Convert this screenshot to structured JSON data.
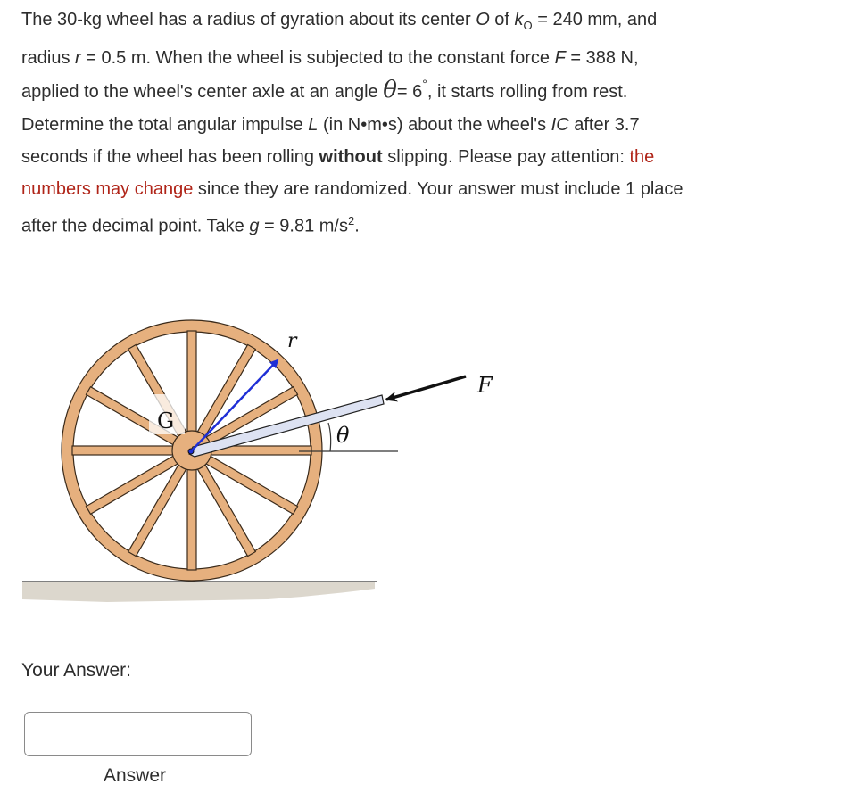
{
  "question": {
    "line1": {
      "a": "The 30-kg wheel has a radius of gyration about its center ",
      "O": "O",
      "b": " of ",
      "k": "k",
      "k_sub": "O",
      "c": " = 240 mm, and"
    },
    "line2": {
      "a": "radius ",
      "r": "r",
      "b": " = 0.5 m. When the wheel is subjected to the constant force ",
      "F": "F",
      "c": " = 388 N,"
    },
    "line3": {
      "a": "applied to the wheel's center axle at an angle ",
      "theta": "θ",
      "b": "= 6",
      "deg": "°",
      "c": ", it starts rolling from rest."
    },
    "line4": {
      "a": "Determine the total angular impulse ",
      "L": "L",
      "b": " (in N•m•s) about the wheel's ",
      "IC": "IC",
      "c": " after 3.7"
    },
    "line5": {
      "a": "seconds if the wheel has been rolling ",
      "bold": "without",
      "b": " slipping. Please pay attention: ",
      "red": "the"
    },
    "line6": {
      "red": "numbers may change",
      "a": " since they are randomized. Your answer must include 1 place"
    },
    "line7": {
      "a": "after the decimal point. Take ",
      "g": "g",
      "b": " = 9.81 m/s",
      "sup": "2",
      "c": "."
    }
  },
  "figure": {
    "label_G": "G",
    "label_r": "r",
    "label_F": "F",
    "label_theta": "θ",
    "colors": {
      "wheel_fill": "#e6b07e",
      "outline": "#3a2a1a",
      "radius_arrow": "#1f2fd6",
      "rotation_arrow": "#d8321e",
      "handle_fill": "#dde2f2",
      "ground": "#dcd7cd"
    }
  },
  "answer": {
    "label": "Your Answer:",
    "value": "",
    "placeholder": "",
    "caption": "Answer"
  }
}
